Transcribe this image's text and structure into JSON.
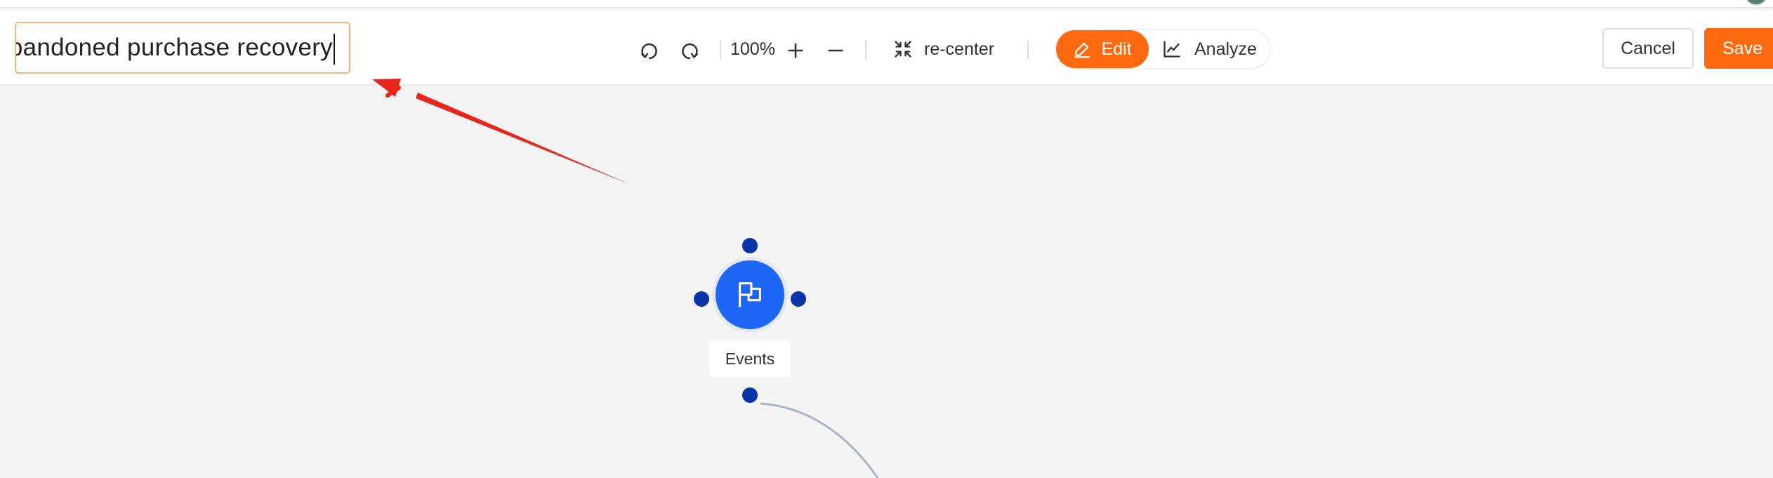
{
  "journey": {
    "name_value": "abandoned purchase recovery"
  },
  "toolbar": {
    "zoom_level": "100%",
    "recenter_label": "re-center",
    "edit_label": "Edit",
    "analyze_label": "Analyze",
    "cancel_label": "Cancel",
    "save_label": "Save"
  },
  "canvas": {
    "node_label": "Events"
  },
  "colors": {
    "accent": "#ff6a10",
    "node": "#1e66f5",
    "handle": "#0a34a8",
    "edge": "#a8b5c9",
    "annotation_arrow": "#e8261c",
    "input_border": "#f2b279"
  },
  "icons": [
    "undo-icon",
    "redo-icon",
    "zoom-in-icon",
    "zoom-out-icon",
    "recenter-icon",
    "pencil-icon",
    "line-chart-icon",
    "flag-icon"
  ]
}
